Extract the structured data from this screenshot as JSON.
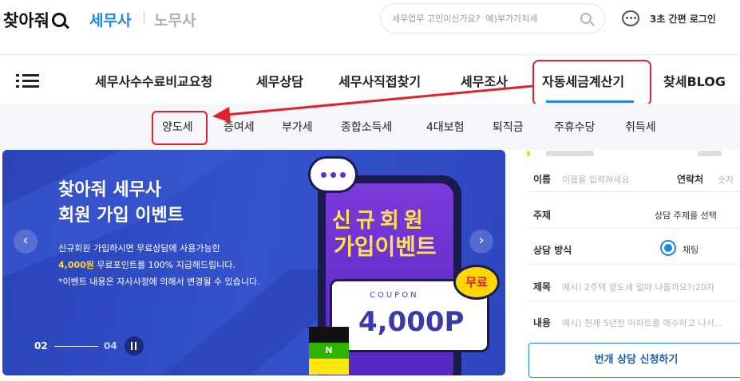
{
  "header": {
    "logo": "찾아줘",
    "brand_tabs": [
      "세무사",
      "노무사"
    ],
    "search_placeholder": "세무업무 고민이신가요?  예)부가가치세",
    "login_label": "3초 간편 로그인"
  },
  "nav": {
    "items": [
      "세무사수수료비교요청",
      "세무상담",
      "세무사직접찾기",
      "세무조사",
      "자동세금계산기",
      "찾세BLOG"
    ],
    "active_index": 4
  },
  "subnav": {
    "items": [
      "양도세",
      "증여세",
      "부가세",
      "종합소득세",
      "4대보험",
      "퇴직금",
      "주휴수당",
      "취득세"
    ],
    "highlighted_index": 0
  },
  "banner": {
    "title_line1": "찾아줘 세무사",
    "title_line2": "회원 가입 이벤트",
    "desc_line1": "신규회원 가입하시면 무료상담에 사용가능한",
    "desc_line2_highlight": "4,000원",
    "desc_line2_rest": " 무료포인트를 100% 지급해드립니다.",
    "desc_line3": "*이벤트 내용은 자사사정에 의해서 변경될 수 있습니다.",
    "phone_text1": "신규회원",
    "phone_text2": "가입이벤트",
    "coupon_label": "COUPON",
    "coupon_value": "4,000P",
    "free_badge": "무료",
    "app_badges": [
      "",
      "N",
      ""
    ],
    "pager_current": "02",
    "pager_total": "04",
    "prev_glyph": "‹",
    "next_glyph": "›"
  },
  "form": {
    "name_label": "이름",
    "name_placeholder": "이름을 입력하세요",
    "contact_label": "연락처",
    "contact_placeholder": "숫자",
    "topic_label": "주제",
    "topic_select": "상담 주제를 선택",
    "method_label": "상담 방식",
    "method_option": "채팅",
    "subject_label": "제목",
    "subject_placeholder": "예시) 2주택 양도세 얼마 나올까요?(20자",
    "content_label": "내용",
    "content_placeholder": "예시) 현재 5년전 아파트를 매수하고 나서...",
    "submit_label": "번개 상담 신청하기"
  },
  "colors": {
    "accent": "#1e88e5",
    "annotation_red": "#e0212e",
    "banner_blue": "#3552cc",
    "coupon_yellow": "#ffe24a"
  }
}
